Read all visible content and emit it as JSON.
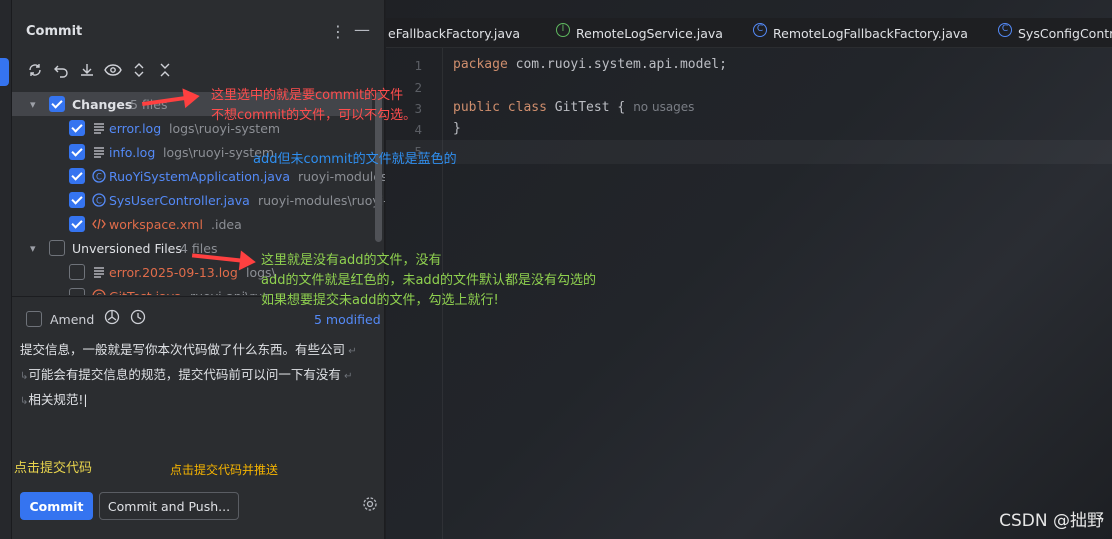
{
  "panel": {
    "title": "Commit",
    "menu_glyph": "⋮",
    "minimize_glyph": "—"
  },
  "toolbar": {
    "icons": [
      "refresh-icon",
      "rollback-icon",
      "download-icon",
      "eye-icon",
      "expand-icon",
      "collapse-icon"
    ]
  },
  "changes": {
    "label": "Changes",
    "count": "5 files",
    "checked": true,
    "files": [
      {
        "name": "error.log",
        "path": "logs\\ruoyi-system",
        "icon": "text-file-icon",
        "color": "#548af7"
      },
      {
        "name": "info.log",
        "path": "logs\\ruoyi-system",
        "icon": "text-file-icon",
        "color": "#548af7"
      },
      {
        "name": "RuoYiSystemApplication.java",
        "path": "ruoyi-modules\\ruo",
        "icon": "java-class-icon",
        "color": "#548af7"
      },
      {
        "name": "SysUserController.java",
        "path": "ruoyi-modules\\ruoyi-sys",
        "icon": "java-class-icon",
        "color": "#548af7"
      },
      {
        "name": "workspace.xml",
        "path": ".idea",
        "icon": "xml-file-icon",
        "color": "#e06c4a"
      }
    ]
  },
  "unversioned": {
    "label": "Unversioned Files",
    "count": "4 files",
    "checked": false,
    "files": [
      {
        "name": "error.2025-09-13.log",
        "path": "logs\\",
        "icon": "text-file-icon",
        "color": "#e06c4a"
      },
      {
        "name": "GitTest.java",
        "path": "ruoyi-api\\ruoy",
        "icon": "java-class-icon",
        "color": "#e06c4a"
      }
    ]
  },
  "amend": {
    "label": "Amend",
    "modified_link": "5 modified"
  },
  "message": {
    "lines": [
      "提交信息，一般就是写你本次代码做了什么东西。有些公司",
      "可能会有提交信息的规范，提交代码前可以问一下有没有",
      "相关规范!"
    ]
  },
  "buttons": {
    "commit": "Commit",
    "commit_and_push": "Commit and Push..."
  },
  "tabs": [
    {
      "label": "eFallbackFactory.java",
      "icon": ""
    },
    {
      "label": "RemoteLogService.java",
      "icon": "I",
      "color": "#5fb85f"
    },
    {
      "label": "RemoteLogFallbackFactory.java",
      "icon": "C",
      "color": "#548af7"
    },
    {
      "label": "SysConfigContro",
      "icon": "C",
      "color": "#548af7"
    }
  ],
  "editor": {
    "line_numbers": [
      "1",
      "2",
      "3",
      "4",
      "5"
    ],
    "line1_kw": "package",
    "line1_rest": " com.ruoyi.system.api.model;",
    "line3_kw": "public class",
    "line3_rest": " GitTest {",
    "line3_hint": "no usages",
    "line4": "}"
  },
  "annotations": {
    "changes_1": "这里选中的就是要commit的文件",
    "changes_2": "不想commit的文件，可以不勾选。",
    "blue": "add但未commit的文件就是蓝色的",
    "unversioned_1": "这里就是没有add的文件，没有",
    "unversioned_2": "add的文件就是红色的，未add的文件默认都是没有勾选的",
    "unversioned_3": "如果想要提交未add的文件，勾选上就行!",
    "commit_hint": "点击提交代码",
    "push_hint": "点击提交代码并推送"
  },
  "watermark": "CSDN @拙野"
}
